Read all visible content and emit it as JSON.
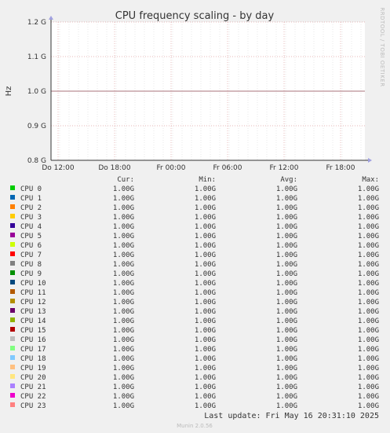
{
  "chart_data": {
    "type": "line",
    "title": "CPU frequency scaling - by day",
    "ylabel": "Hz",
    "xlabel": "",
    "side_label": "RRDTOOL / TOBI OETIKER",
    "ylim": [
      0.8,
      1.2
    ],
    "yticks": [
      {
        "value": 0.8,
        "label": "0.8 G"
      },
      {
        "value": 0.9,
        "label": "0.9 G"
      },
      {
        "value": 1.0,
        "label": "1.0 G"
      },
      {
        "value": 1.1,
        "label": "1.1 G"
      },
      {
        "value": 1.2,
        "label": "1.2 G"
      }
    ],
    "xticks": [
      "Do 12:00",
      "Do 18:00",
      "Fr 00:00",
      "Fr 06:00",
      "Fr 12:00",
      "Fr 18:00"
    ],
    "grid": true,
    "colors": {
      "background": "#f0f0f0",
      "plot": "#ffffff",
      "major_grid": "#e0a0a0",
      "minor_grid": "#dcdcdc",
      "line": "#a9737b"
    },
    "series_value": 1.0,
    "legend_headers": {
      "cur": "Cur:",
      "min": "Min:",
      "avg": "Avg:",
      "max": "Max:"
    },
    "series": [
      {
        "name": "CPU 0",
        "color": "#00cc00",
        "cur": "1.00G",
        "min": "1.00G",
        "avg": "1.00G",
        "max": "1.00G"
      },
      {
        "name": "CPU 1",
        "color": "#0066b3",
        "cur": "1.00G",
        "min": "1.00G",
        "avg": "1.00G",
        "max": "1.00G"
      },
      {
        "name": "CPU 2",
        "color": "#ff8000",
        "cur": "1.00G",
        "min": "1.00G",
        "avg": "1.00G",
        "max": "1.00G"
      },
      {
        "name": "CPU 3",
        "color": "#ffcc00",
        "cur": "1.00G",
        "min": "1.00G",
        "avg": "1.00G",
        "max": "1.00G"
      },
      {
        "name": "CPU 4",
        "color": "#330099",
        "cur": "1.00G",
        "min": "1.00G",
        "avg": "1.00G",
        "max": "1.00G"
      },
      {
        "name": "CPU 5",
        "color": "#990099",
        "cur": "1.00G",
        "min": "1.00G",
        "avg": "1.00G",
        "max": "1.00G"
      },
      {
        "name": "CPU 6",
        "color": "#ccff00",
        "cur": "1.00G",
        "min": "1.00G",
        "avg": "1.00G",
        "max": "1.00G"
      },
      {
        "name": "CPU 7",
        "color": "#ff0000",
        "cur": "1.00G",
        "min": "1.00G",
        "avg": "1.00G",
        "max": "1.00G"
      },
      {
        "name": "CPU 8",
        "color": "#808080",
        "cur": "1.00G",
        "min": "1.00G",
        "avg": "1.00G",
        "max": "1.00G"
      },
      {
        "name": "CPU 9",
        "color": "#008f00",
        "cur": "1.00G",
        "min": "1.00G",
        "avg": "1.00G",
        "max": "1.00G"
      },
      {
        "name": "CPU 10",
        "color": "#00487d",
        "cur": "1.00G",
        "min": "1.00G",
        "avg": "1.00G",
        "max": "1.00G"
      },
      {
        "name": "CPU 11",
        "color": "#b35a00",
        "cur": "1.00G",
        "min": "1.00G",
        "avg": "1.00G",
        "max": "1.00G"
      },
      {
        "name": "CPU 12",
        "color": "#b38f00",
        "cur": "1.00G",
        "min": "1.00G",
        "avg": "1.00G",
        "max": "1.00G"
      },
      {
        "name": "CPU 13",
        "color": "#6b006b",
        "cur": "1.00G",
        "min": "1.00G",
        "avg": "1.00G",
        "max": "1.00G"
      },
      {
        "name": "CPU 14",
        "color": "#8fb300",
        "cur": "1.00G",
        "min": "1.00G",
        "avg": "1.00G",
        "max": "1.00G"
      },
      {
        "name": "CPU 15",
        "color": "#b30000",
        "cur": "1.00G",
        "min": "1.00G",
        "avg": "1.00G",
        "max": "1.00G"
      },
      {
        "name": "CPU 16",
        "color": "#bebebe",
        "cur": "1.00G",
        "min": "1.00G",
        "avg": "1.00G",
        "max": "1.00G"
      },
      {
        "name": "CPU 17",
        "color": "#80ff80",
        "cur": "1.00G",
        "min": "1.00G",
        "avg": "1.00G",
        "max": "1.00G"
      },
      {
        "name": "CPU 18",
        "color": "#80c9ff",
        "cur": "1.00G",
        "min": "1.00G",
        "avg": "1.00G",
        "max": "1.00G"
      },
      {
        "name": "CPU 19",
        "color": "#ffc080",
        "cur": "1.00G",
        "min": "1.00G",
        "avg": "1.00G",
        "max": "1.00G"
      },
      {
        "name": "CPU 20",
        "color": "#ffe680",
        "cur": "1.00G",
        "min": "1.00G",
        "avg": "1.00G",
        "max": "1.00G"
      },
      {
        "name": "CPU 21",
        "color": "#aa80ff",
        "cur": "1.00G",
        "min": "1.00G",
        "avg": "1.00G",
        "max": "1.00G"
      },
      {
        "name": "CPU 22",
        "color": "#ee00cc",
        "cur": "1.00G",
        "min": "1.00G",
        "avg": "1.00G",
        "max": "1.00G"
      },
      {
        "name": "CPU 23",
        "color": "#ff8080",
        "cur": "1.00G",
        "min": "1.00G",
        "avg": "1.00G",
        "max": "1.00G"
      }
    ]
  },
  "footer": {
    "last_update": "Last update: Fri May 16 20:31:10 2025",
    "version": "Munin 2.0.56"
  }
}
